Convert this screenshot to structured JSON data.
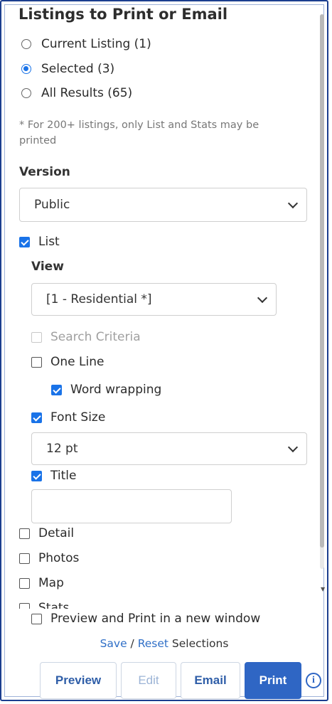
{
  "panel": {
    "title": "Listings to Print or Email"
  },
  "scope": {
    "options": [
      {
        "label": "Current Listing (1)",
        "selected": false
      },
      {
        "label": "Selected (3)",
        "selected": true
      },
      {
        "label": "All Results (65)",
        "selected": false
      }
    ],
    "note": "* For 200+ listings, only List and Stats may be printed"
  },
  "version": {
    "label": "Version",
    "value": "Public"
  },
  "list": {
    "label": "List",
    "checked": true,
    "view_label": "View",
    "view_value": "[1 - Residential *]",
    "search_criteria": {
      "label": "Search Criteria",
      "checked": false,
      "disabled": true
    },
    "one_line": {
      "label": "One Line",
      "checked": false
    },
    "word_wrapping": {
      "label": "Word wrapping",
      "checked": true
    },
    "font_size": {
      "label": "Font Size",
      "checked": true,
      "value": "12 pt"
    },
    "title": {
      "label": "Title",
      "checked": true,
      "value": ""
    }
  },
  "sections": [
    {
      "label": "Detail",
      "checked": false
    },
    {
      "label": "Photos",
      "checked": false
    },
    {
      "label": "Map",
      "checked": false
    },
    {
      "label": "Stats",
      "checked": false
    }
  ],
  "preview_new_window": {
    "label": "Preview and Print in a new window",
    "checked": false
  },
  "selections": {
    "save": "Save",
    "separator": " / ",
    "reset": "Reset",
    "suffix": " Selections"
  },
  "buttons": {
    "preview": "Preview",
    "edit": "Edit",
    "email": "Email",
    "print": "Print"
  },
  "icons": {
    "info": "info-icon",
    "dropdown": "chevron-down-icon"
  },
  "colors": {
    "accent": "#1a73e8",
    "primary_button": "#2f66c4",
    "link": "#2f6fc7",
    "frame": "#1b3e8f"
  }
}
